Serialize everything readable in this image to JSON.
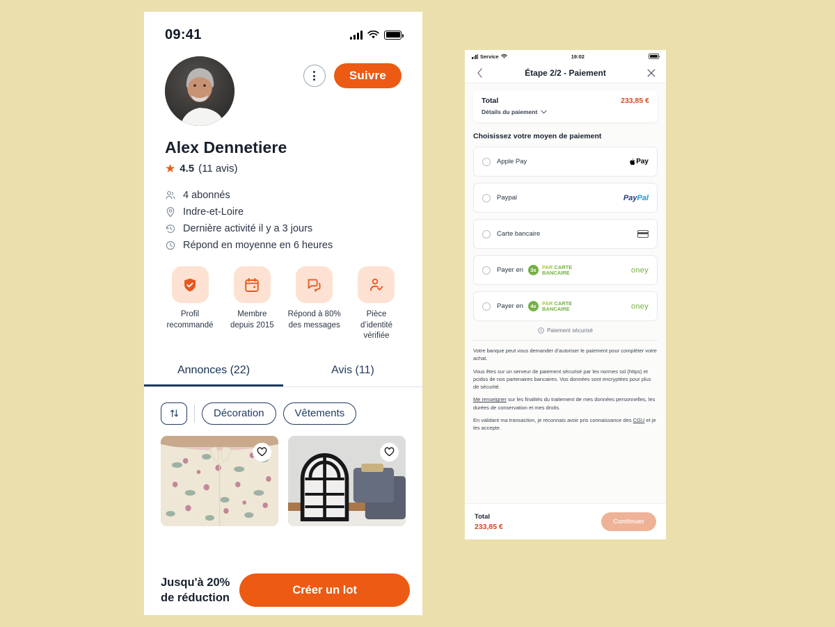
{
  "colors": {
    "page_background": "#ecdfae",
    "accent_orange": "#ec5a13",
    "navy": "#1f3a5f",
    "oney_green": "#76b043",
    "price_orange": "#d2491b"
  },
  "left_phone": {
    "status_bar": {
      "time": "09:41",
      "signal_icon": "cellular-bars-icon",
      "wifi_icon": "wifi-icon",
      "battery_icon": "battery-full-icon"
    },
    "profile": {
      "avatar_name": "avatar",
      "more_button": "more-options",
      "follow_label": "Suivre",
      "name": "Alex Dennetiere",
      "rating_value": "4.5",
      "rating_count": "(11 avis)",
      "star_glyph": "★"
    },
    "info_rows": [
      {
        "icon": "users-icon",
        "text": "4 abonnés"
      },
      {
        "icon": "location-pin-icon",
        "text": "Indre-et-Loire"
      },
      {
        "icon": "history-clock-icon",
        "text": "Dernière activité il y a 3 jours"
      },
      {
        "icon": "clock-icon",
        "text": "Répond en moyenne en 6 heures"
      }
    ],
    "badges": [
      {
        "icon": "shield-check-icon",
        "line1": "Profil",
        "line2": "recommandé",
        "line3": ""
      },
      {
        "icon": "calendar-icon",
        "line1": "Membre",
        "line2": "depuis 2015",
        "line3": ""
      },
      {
        "icon": "chat-bubbles-icon",
        "line1": "Répond à 80%",
        "line2": "des messages",
        "line3": ""
      },
      {
        "icon": "user-verified-icon",
        "line1": "Pièce",
        "line2": "d’identité",
        "line3": "vérifiée"
      }
    ],
    "tabs": [
      {
        "label": "Annonces (22)",
        "active": true
      },
      {
        "label": "Avis (11)",
        "active": false
      }
    ],
    "filters": {
      "sort_icon": "sort-arrows-icon",
      "chips": [
        "Décoration",
        "Vêtements"
      ]
    },
    "listings": [
      {
        "name": "floral-shirt-photo",
        "favorite_icon": "heart-outline-icon"
      },
      {
        "name": "arched-mirror-photo",
        "favorite_icon": "heart-outline-icon"
      }
    ],
    "bottom_bar": {
      "promo_line1": "Jusqu'à 20%",
      "promo_line2": "de réduction",
      "cta_label": "Créer un lot"
    }
  },
  "right_phone": {
    "status_bar": {
      "signal_icon": "cellular-bars-icon",
      "carrier": "Service",
      "wifi_icon": "wifi-icon",
      "time": "19:02",
      "battery_icon": "battery-icon"
    },
    "nav": {
      "back_icon": "chevron-left-icon",
      "title": "Étape 2/2 - Paiement",
      "close_icon": "close-icon"
    },
    "total_card": {
      "label": "Total",
      "amount": "233,85 €",
      "details_label": "Détails du paiement",
      "chevron_icon": "chevron-down-icon"
    },
    "section_title": "Choisissez votre moyen de paiement",
    "payment_options": [
      {
        "name": "Apple Pay",
        "logo": "apple-pay-logo",
        "logo_text": "Pay",
        "selected": false
      },
      {
        "name": "Paypal",
        "logo": "paypal-logo",
        "logo_text_1": "Pay",
        "logo_text_2": "Pal",
        "selected": false
      },
      {
        "name": "Carte bancaire",
        "logo": "credit-card-icon",
        "selected": false
      },
      {
        "name": "Payer en",
        "logo": "oney-logo",
        "installments": "3x",
        "logo_line1": "PAR",
        "logo_line1b": "CARTE",
        "logo_line2": "BANCAIRE",
        "brand": "oney",
        "selected": false
      },
      {
        "name": "Payer en",
        "logo": "oney-logo",
        "installments": "4x",
        "logo_line1": "PAR",
        "logo_line1b": "CARTE",
        "logo_line2": "BANCAIRE",
        "brand": "oney",
        "selected": false
      }
    ],
    "secure_note": {
      "icon": "shield-secure-icon",
      "text": "Paiement sécurisé"
    },
    "legal": [
      "Votre banque peut vous demander d’autoriser le paiement pour compléter votre achat.",
      "Vous êtes sur un serveur de paiement sécurisé par les normes ssl (https) et pcidss de nos partenaires bancaires. Vos données sont encryptées pour plus de sécurité.",
      "Me renseigner sur les finalités du traitement de mes données personnelles, les durées de conservation et mes droits.",
      "En validant ma transaction, je reconnais avoir pris connaissance des CGU et je les accepte."
    ],
    "legal_links": {
      "link1": "Me renseigner",
      "link2": "CGU"
    },
    "footer": {
      "total_label": "Total",
      "total_amount": "233,85 €",
      "continue_label": "Continuer"
    }
  }
}
